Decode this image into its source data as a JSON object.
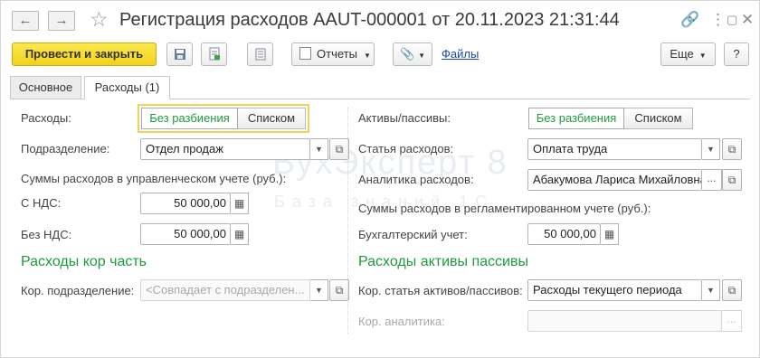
{
  "window": {
    "title": "Регистрация расходов AAUT-000001 от 20.11.2023 21:31:44",
    "icons": {
      "back": "arrow-left-icon",
      "forward": "arrow-right-icon",
      "favorite": "star-icon",
      "link": "link-icon",
      "more": "more-vertical-icon",
      "maximize": "maximize-icon",
      "close": "close-icon"
    }
  },
  "toolbar": {
    "post_close_label": "Провести и закрыть",
    "reports_label": "Отчеты",
    "files_label": "Файлы",
    "more_label": "Еще",
    "help_label": "?",
    "primary_color": "#f5d926"
  },
  "tabs": [
    {
      "label": "Основное",
      "active": false
    },
    {
      "label": "Расходы (1)",
      "active": true
    }
  ],
  "watermark": {
    "line1": "БухЭксперт 8",
    "line2": "База знаний 1С"
  },
  "left": {
    "expenses_label": "Расходы:",
    "switch_no_split": "Без разбиения",
    "switch_list": "Списком",
    "department_label": "Подразделение:",
    "department_value": "Отдел продаж",
    "mgmt_sums_label": "Суммы расходов в управленческом учете (руб.):",
    "with_vat_label": "С НДС:",
    "with_vat_value": "50 000,00",
    "without_vat_label": "Без НДС:",
    "without_vat_value": "50 000,00",
    "section_title": "Расходы кор часть",
    "corr_department_label": "Кор. подразделение:",
    "corr_department_placeholder": "<Совпадает с подразделен..."
  },
  "right": {
    "assets_label": "Активы/пассивы:",
    "switch_no_split": "Без разбиения",
    "switch_list": "Списком",
    "expense_item_label": "Статья расходов:",
    "expense_item_value": "Оплата труда",
    "analytics_label": "Аналитика расходов:",
    "analytics_value": "Абакумова Лариса Михайловна",
    "regl_sums_label": "Суммы расходов в регламентированном учете (руб.):",
    "accounting_label": "Бухгалтерский учет:",
    "accounting_value": "50 000,00",
    "section_title": "Расходы активы пассивы",
    "corr_item_label": "Кор. статья активов/пассивов:",
    "corr_item_value": "Расходы текущего периода",
    "corr_analytics_label": "Кор. аналитика:",
    "corr_analytics_value": ""
  },
  "colors": {
    "section_green": "#1f9a3e",
    "link_blue": "#1e47a8"
  }
}
